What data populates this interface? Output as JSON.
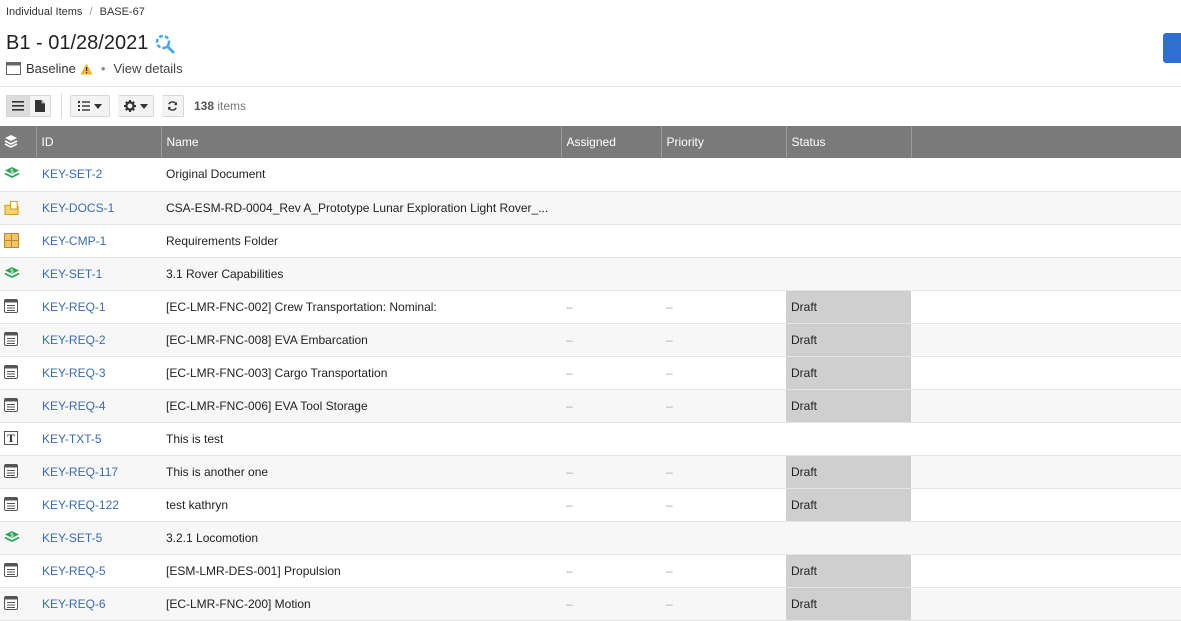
{
  "breadcrumb": {
    "root": "Individual Items",
    "separator": "/",
    "current": "BASE-67"
  },
  "header": {
    "title": "B1 - 01/28/2021",
    "subtitle_type": "Baseline",
    "subtitle_dot": "•",
    "view_details": "View details"
  },
  "toolbar": {
    "count": "138",
    "count_suffix": "items"
  },
  "table": {
    "columns": [
      "ID",
      "Name",
      "Assigned",
      "Priority",
      "Status"
    ],
    "rows": [
      {
        "icon": "set-icon",
        "id": "KEY-SET-2",
        "name": "Original Document",
        "assigned": "",
        "priority": "",
        "status": ""
      },
      {
        "icon": "document-folder-icon",
        "id": "KEY-DOCS-1",
        "name": "CSA-ESM-RD-0004_Rev A_Prototype Lunar Exploration Light Rover_...",
        "assigned": "",
        "priority": "",
        "status": ""
      },
      {
        "icon": "component-icon",
        "id": "KEY-CMP-1",
        "name": "Requirements Folder",
        "assigned": "",
        "priority": "",
        "status": ""
      },
      {
        "icon": "set-icon",
        "id": "KEY-SET-1",
        "name": "3.1 Rover Capabilities",
        "assigned": "",
        "priority": "",
        "status": ""
      },
      {
        "icon": "requirement-icon",
        "id": "KEY-REQ-1",
        "name": "[EC-LMR-FNC-002] Crew Transportation: Nominal:",
        "assigned": "–",
        "priority": "–",
        "status": "Draft"
      },
      {
        "icon": "requirement-icon",
        "id": "KEY-REQ-2",
        "name": "[EC-LMR-FNC-008] EVA Embarcation",
        "assigned": "–",
        "priority": "–",
        "status": "Draft"
      },
      {
        "icon": "requirement-icon",
        "id": "KEY-REQ-3",
        "name": "[EC-LMR-FNC-003] Cargo Transportation",
        "assigned": "–",
        "priority": "–",
        "status": "Draft"
      },
      {
        "icon": "requirement-icon",
        "id": "KEY-REQ-4",
        "name": "[EC-LMR-FNC-006] EVA Tool Storage",
        "assigned": "–",
        "priority": "–",
        "status": "Draft"
      },
      {
        "icon": "text-icon",
        "id": "KEY-TXT-5",
        "name": "This is test",
        "assigned": "",
        "priority": "",
        "status": ""
      },
      {
        "icon": "requirement-icon",
        "id": "KEY-REQ-117",
        "name": "This is another one",
        "assigned": "–",
        "priority": "–",
        "status": "Draft"
      },
      {
        "icon": "requirement-icon",
        "id": "KEY-REQ-122",
        "name": "test kathryn",
        "assigned": "–",
        "priority": "–",
        "status": "Draft"
      },
      {
        "icon": "set-icon",
        "id": "KEY-SET-5",
        "name": "3.2.1 Locomotion",
        "assigned": "",
        "priority": "",
        "status": ""
      },
      {
        "icon": "requirement-icon",
        "id": "KEY-REQ-5",
        "name": "[ESM-LMR-DES-001] Propulsion",
        "assigned": "–",
        "priority": "–",
        "status": "Draft"
      },
      {
        "icon": "requirement-icon",
        "id": "KEY-REQ-6",
        "name": "[EC-LMR-FNC-200] Motion",
        "assigned": "–",
        "priority": "–",
        "status": "Draft"
      }
    ]
  },
  "colors": {
    "header_bg": "#7a7a7a",
    "link": "#3a6bb0",
    "status_draft_bg": "#cfcfcf",
    "set_icon": "#2fa35a",
    "primary_button": "#2e6fd1"
  }
}
